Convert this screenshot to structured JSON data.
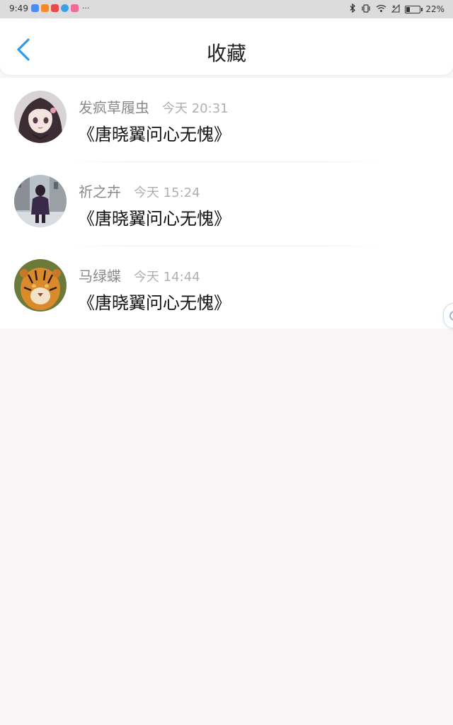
{
  "status_bar": {
    "time": "9:49",
    "more": "···",
    "battery": "22%",
    "battery_level": 0.22,
    "app_icons": [
      {
        "name": "app-icon-blue",
        "color": "#4a8cf0"
      },
      {
        "name": "app-icon-orange",
        "color": "#f38a2b"
      },
      {
        "name": "app-icon-red",
        "color": "#e84a4a"
      },
      {
        "name": "app-icon-lightblue",
        "color": "#3aa0e8"
      },
      {
        "name": "app-icon-multicolor",
        "color": "#f06a9a"
      }
    ],
    "right_icons": [
      "bluetooth-icon",
      "vibrate-icon",
      "wifi-icon",
      "signal-icon"
    ]
  },
  "header": {
    "title": "收藏",
    "back_icon": "chevron-left-icon",
    "back_color": "#2b9af3"
  },
  "favorites": [
    {
      "user": "发疯草履虫",
      "time": "今天 20:31",
      "title": "《唐晓翼问心无愧》",
      "avatar": "anime-girl-avatar"
    },
    {
      "user": "祈之卉",
      "time": "今天 15:24",
      "title": "《唐晓翼问心无愧》",
      "avatar": "street-photo-avatar"
    },
    {
      "user": "马绿蝶",
      "time": "今天 14:44",
      "title": "《唐晓翼问心无愧》",
      "avatar": "tiger-avatar"
    }
  ]
}
